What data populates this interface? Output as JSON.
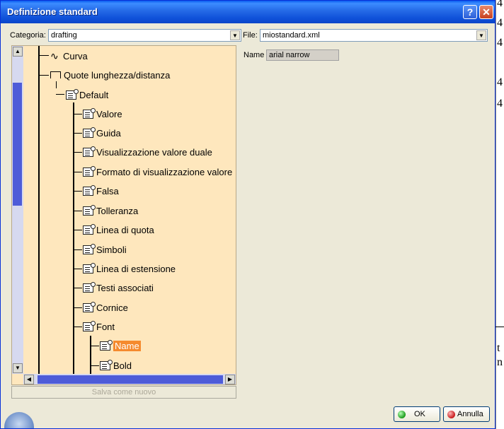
{
  "window": {
    "title": "Definizione standard",
    "help_symbol": "?",
    "close_symbol": "✕"
  },
  "category": {
    "label": "Categoria:",
    "value": "drafting"
  },
  "file": {
    "label": "File:",
    "value": "miostandard.xml"
  },
  "tree": {
    "nodes": [
      {
        "label": "Curva"
      },
      {
        "label": "Quote lunghezza/distanza"
      },
      {
        "label": "Default"
      },
      {
        "label": "Valore"
      },
      {
        "label": "Guida"
      },
      {
        "label": "Visualizzazione valore duale"
      },
      {
        "label": "Formato di visualizzazione valore"
      },
      {
        "label": "Falsa"
      },
      {
        "label": "Tolleranza"
      },
      {
        "label": "Linea di quota"
      },
      {
        "label": "Simboli"
      },
      {
        "label": "Linea di estensione"
      },
      {
        "label": "Testi associati"
      },
      {
        "label": "Cornice"
      },
      {
        "label": "Font"
      },
      {
        "label": "Name",
        "selected": true
      },
      {
        "label": "Bold"
      }
    ]
  },
  "properties": {
    "name_label": "Name",
    "name_value": "arial narrow"
  },
  "buttons": {
    "save_as_new": "Salva come nuovo",
    "ok": "OK",
    "cancel": "Annulla"
  },
  "background": {
    "digits": [
      "4",
      "4",
      "4",
      "4",
      "4",
      "t",
      "n"
    ]
  },
  "colors": {
    "tree_background": "#fee7bd",
    "selection": "#f58a2e",
    "titlebar": "#0e4fd8"
  }
}
